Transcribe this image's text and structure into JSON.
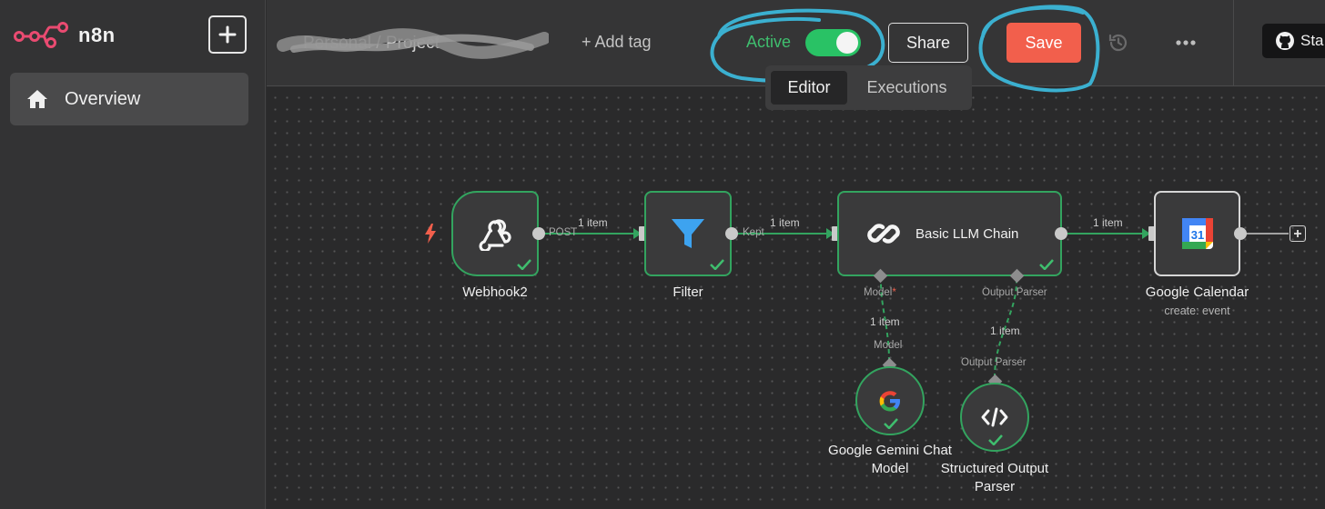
{
  "app": {
    "name": "n8n"
  },
  "sidebar": {
    "add_button_label": "+",
    "items": [
      {
        "label": "Overview",
        "icon": "home-icon"
      }
    ]
  },
  "header": {
    "workflow_name": "Personal / Project",
    "add_tag": "+ Add tag",
    "active_label": "Active",
    "active": true,
    "share_label": "Share",
    "save_label": "Save",
    "star_label": "Sta"
  },
  "tabs": [
    {
      "label": "Editor",
      "selected": true
    },
    {
      "label": "Executions",
      "selected": false
    }
  ],
  "nodes": {
    "webhook": {
      "title": "Webhook2",
      "output_label": "POST",
      "icon": "webhook-icon"
    },
    "filter": {
      "title": "Filter",
      "output_label": "Kept",
      "icon": "funnel-icon"
    },
    "llm": {
      "title": "Basic LLM Chain",
      "port_model": "Model",
      "port_model_required": "*",
      "port_parser": "Output Parser",
      "icon": "link-icon"
    },
    "gcal": {
      "title": "Google Calendar",
      "subtitle": "create: event",
      "icon_text": "31"
    },
    "gemini": {
      "title": "Google Gemini Chat Model",
      "port_label": "Model",
      "icon": "google-g-icon"
    },
    "parser": {
      "title": "Structured Output Parser",
      "port_label": "Output Parser",
      "icon": "code-icon"
    }
  },
  "edges": [
    {
      "from": "webhook",
      "to": "filter",
      "label": "1 item"
    },
    {
      "from": "filter",
      "to": "llm",
      "label": "1 item"
    },
    {
      "from": "llm",
      "to": "gcal",
      "label": "1 item"
    },
    {
      "from": "gemini",
      "to": "llm",
      "label": "1 item"
    },
    {
      "from": "parser",
      "to": "llm",
      "label": "1 item"
    }
  ],
  "colors": {
    "accent": "#f25f4c",
    "success": "#33a45f",
    "toggle": "#29c265",
    "annotation": "#3bb0d0"
  }
}
